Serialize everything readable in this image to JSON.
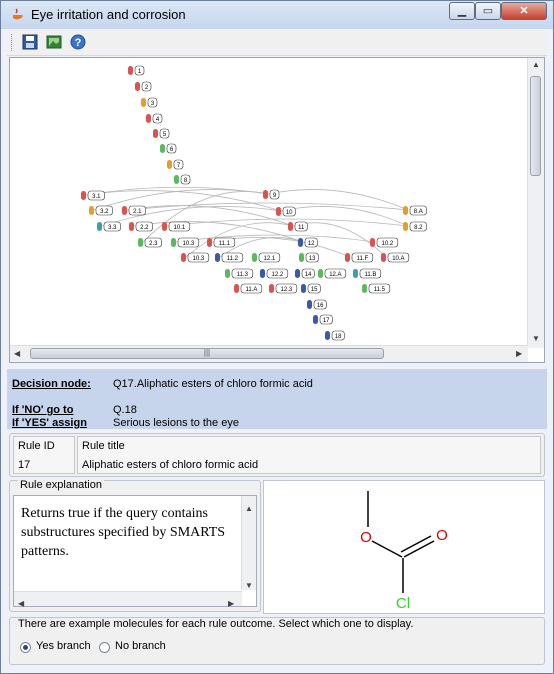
{
  "window": {
    "title": "Eye irritation and corrosion",
    "min_label": "▁",
    "max_label": "▭",
    "close_label": "✕"
  },
  "toolbar": {
    "icons": [
      "save-icon",
      "image-icon",
      "help-icon"
    ]
  },
  "graph": {
    "scroll_grip": "|||",
    "nodes": [
      {
        "label": "1"
      },
      {
        "label": "2"
      },
      {
        "label": "3"
      },
      {
        "label": "4"
      },
      {
        "label": "5"
      },
      {
        "label": "6"
      },
      {
        "label": "7"
      },
      {
        "label": "8"
      },
      {
        "label": "3.1"
      },
      {
        "label": "9"
      },
      {
        "label": "3.2"
      },
      {
        "label": "2.1"
      },
      {
        "label": "10"
      },
      {
        "label": "3.3"
      },
      {
        "label": "2.2"
      },
      {
        "label": "10.1"
      },
      {
        "label": "11"
      },
      {
        "label": "8.A"
      },
      {
        "label": "8.2"
      },
      {
        "label": "2.3"
      },
      {
        "label": "10.3"
      },
      {
        "label": "11.1"
      },
      {
        "label": "12"
      },
      {
        "label": "10.2"
      },
      {
        "label": "10.3"
      },
      {
        "label": "11.2"
      },
      {
        "label": "12.1"
      },
      {
        "label": "13"
      },
      {
        "label": "11.F"
      },
      {
        "label": "10.A"
      },
      {
        "label": "11.3"
      },
      {
        "label": "12.2"
      },
      {
        "label": "14"
      },
      {
        "label": "12.A"
      },
      {
        "label": "11.B"
      },
      {
        "label": "11.A"
      },
      {
        "label": "12.3"
      },
      {
        "label": "15"
      },
      {
        "label": "11.5"
      },
      {
        "label": "16"
      },
      {
        "label": "17"
      },
      {
        "label": "18"
      }
    ]
  },
  "decision": {
    "node_label": "Decision node:",
    "node_value": "Q17.Aliphatic esters of chloro formic acid",
    "no_label": "If 'NO' go to",
    "no_value": "Q.18",
    "yes_label": "If 'YES' assign",
    "yes_value": "Serious lesions to the eye"
  },
  "rule": {
    "id_header": "Rule ID",
    "id_value": "17",
    "title_header": "Rule title",
    "title_value": "Aliphatic esters of chloro formic acid"
  },
  "explanation": {
    "legend": "Rule explanation",
    "text": "Returns true if the query contains substructures specified by SMARTS patterns."
  },
  "molecule": {
    "atoms": {
      "o1": "O",
      "o2": "O",
      "cl": "Cl"
    },
    "colors": {
      "oxygen": "#e00000",
      "chlorine": "#22dd22",
      "bond": "#000000"
    }
  },
  "branch": {
    "message": "There are example molecules for each rule outcome. Select which one to display.",
    "yes_label": "Yes branch",
    "no_label": "No branch",
    "selected": "yes"
  },
  "colors": {
    "decision_bg": "#c7d5ec",
    "node_red": "#d9534f",
    "node_green": "#5cb85c",
    "node_orange": "#e0a030",
    "node_blue": "#3a5aa8",
    "node_teal": "#3aa0a8"
  }
}
